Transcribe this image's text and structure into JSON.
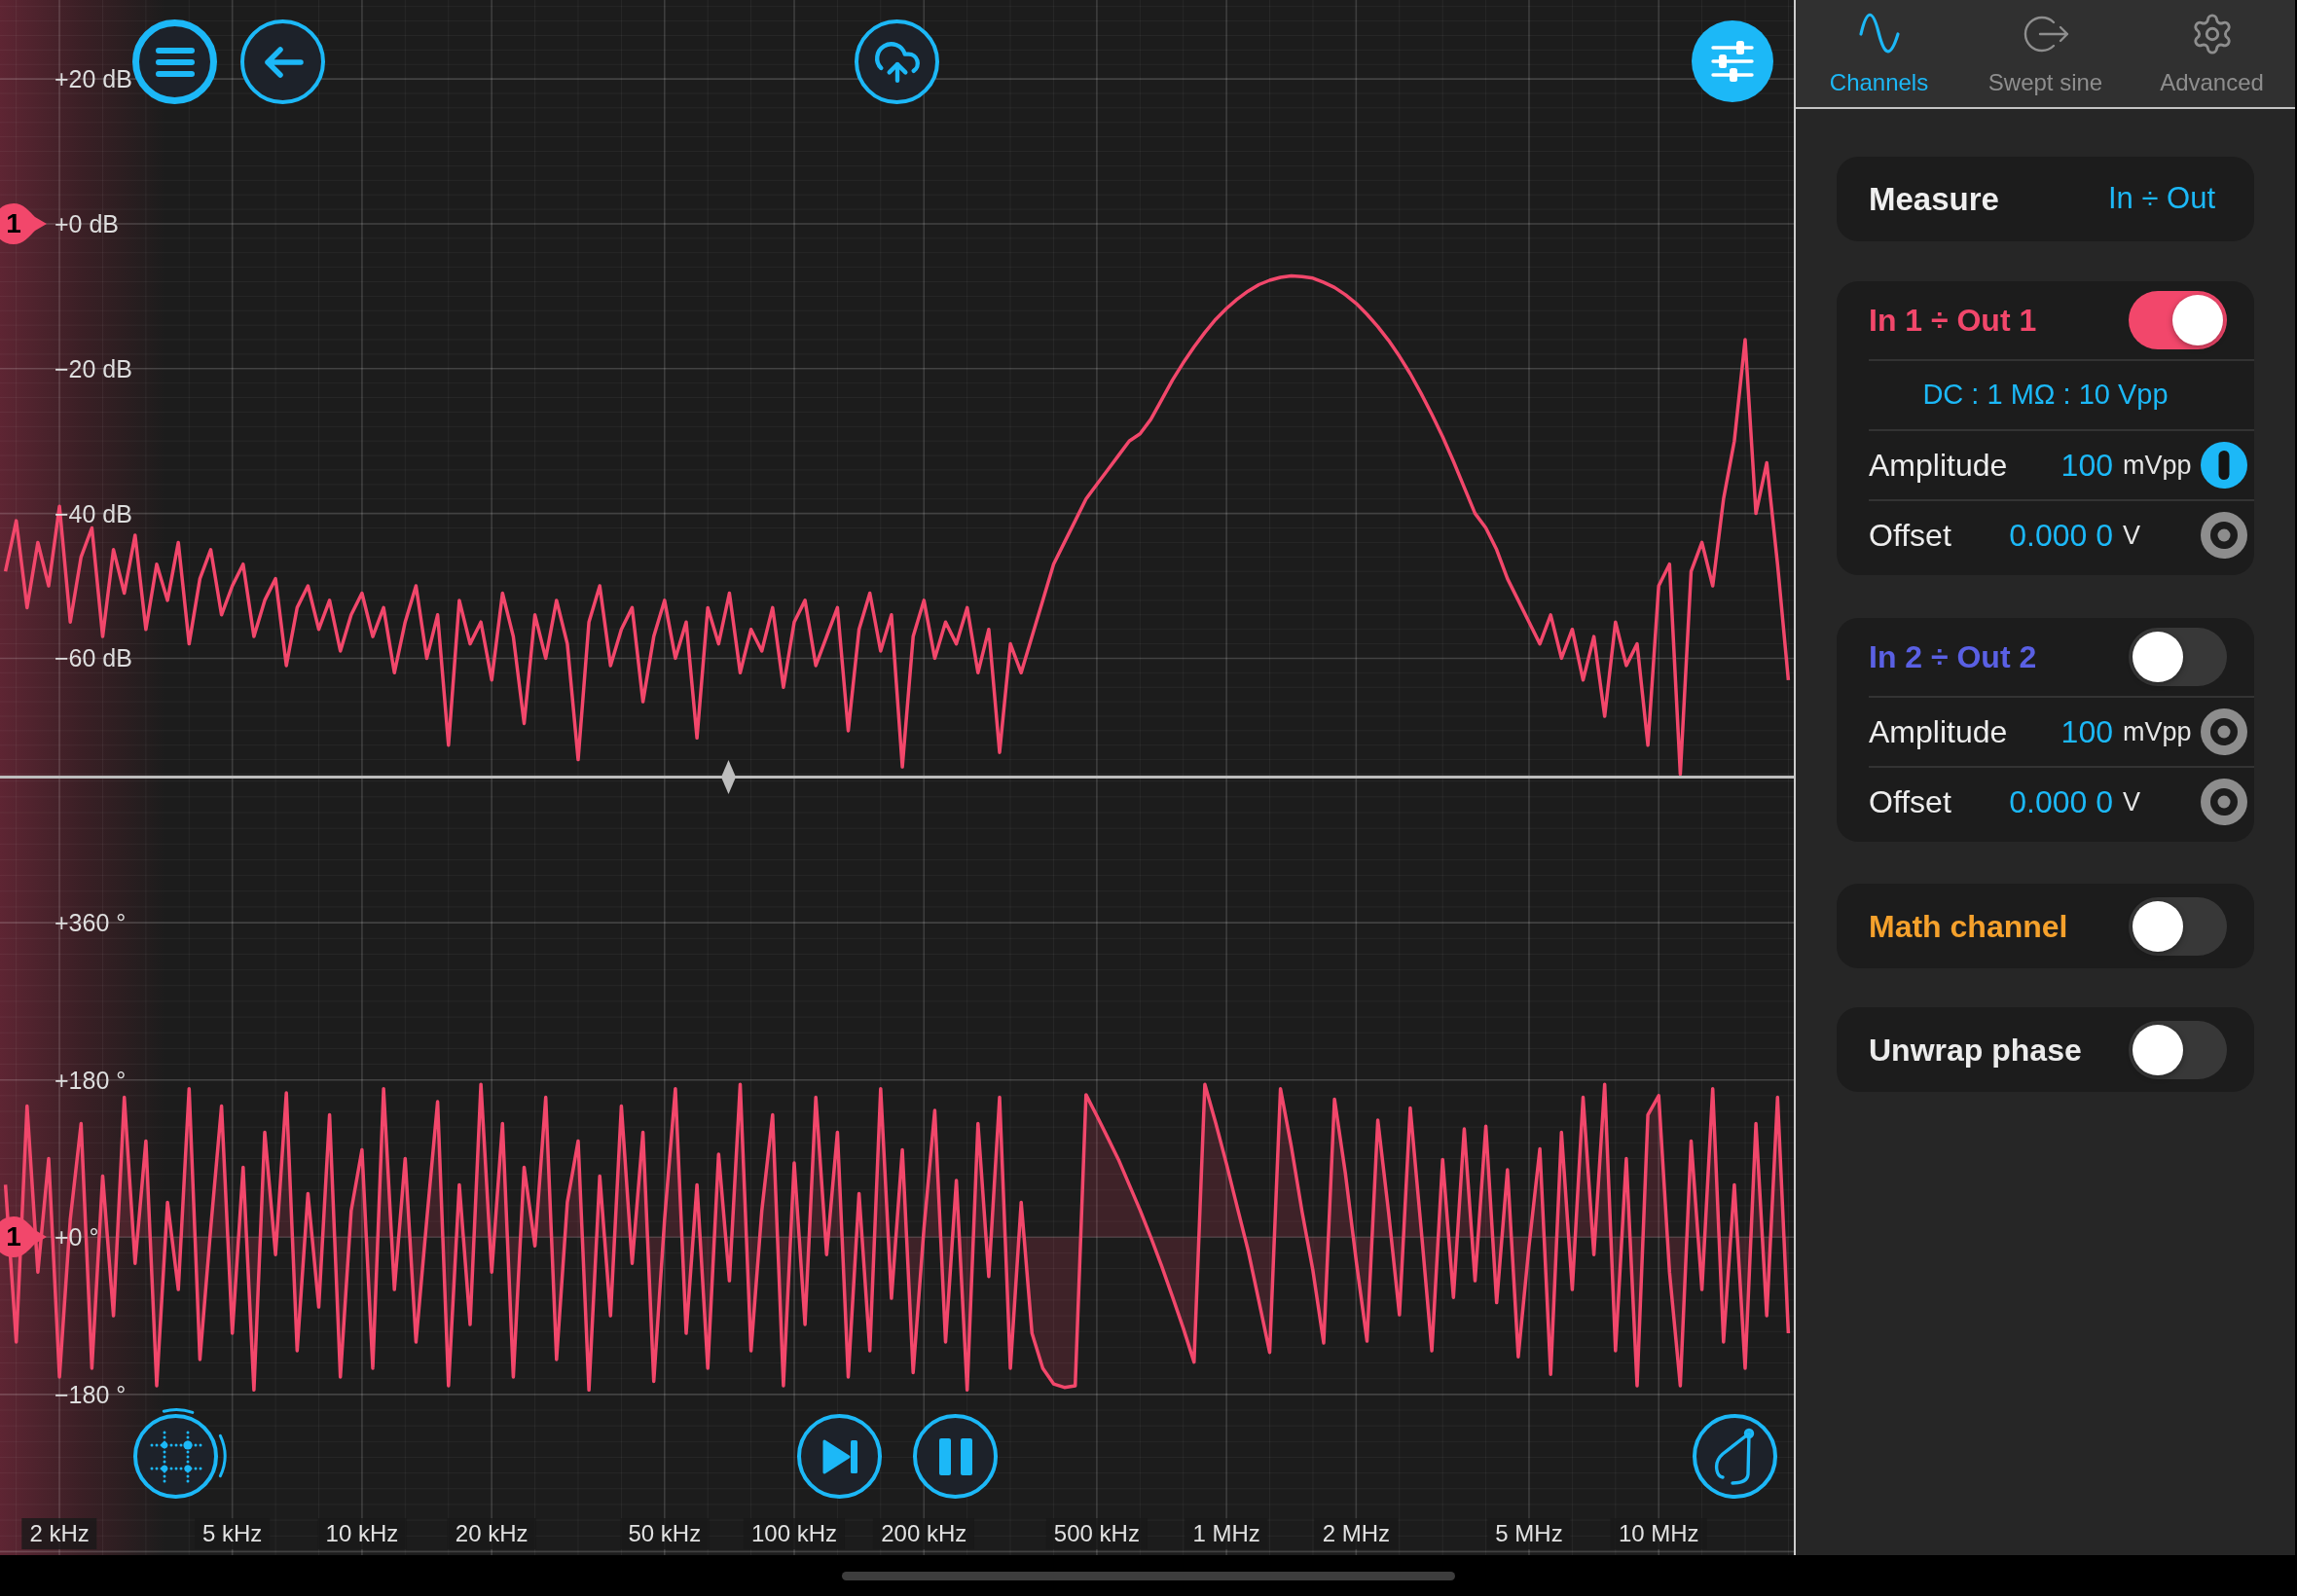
{
  "magnitude_chart": {
    "marker": "1",
    "chart_data": {
      "type": "line",
      "grid": true,
      "ylim": [
        -76.2,
        30.9
      ],
      "yticks": [
        {
          "value": 20,
          "label": "+20 dB"
        },
        {
          "value": 0,
          "label": "+0 dB"
        },
        {
          "value": -20,
          "label": "−20 dB"
        },
        {
          "value": -40,
          "label": "−40 dB"
        },
        {
          "value": -60,
          "label": "−60 dB"
        }
      ],
      "categories": [
        null,
        null,
        null,
        null,
        null,
        null,
        null,
        null,
        null,
        null,
        null,
        null,
        null,
        null,
        null,
        null,
        null,
        null,
        null,
        null,
        null,
        null,
        null,
        null,
        null,
        null,
        null,
        null,
        null,
        null,
        null,
        null,
        null,
        null,
        null,
        null,
        null,
        null,
        null,
        null,
        null,
        null,
        null,
        null,
        null,
        null,
        null,
        null,
        null,
        null,
        null,
        null,
        null,
        null,
        null,
        null,
        null,
        null,
        null,
        null,
        null,
        null,
        null,
        null,
        null,
        null,
        null,
        null,
        null,
        null,
        null,
        null,
        null,
        null,
        null,
        null,
        null,
        null,
        null,
        null,
        null,
        null,
        null,
        null,
        null,
        null,
        null,
        null,
        null,
        null,
        null,
        null,
        null,
        null,
        null,
        null,
        null,
        null,
        null,
        null,
        null,
        null,
        null,
        null,
        null,
        null,
        null,
        null,
        null,
        null,
        null,
        null,
        null,
        null,
        null,
        null,
        null,
        null,
        null,
        null,
        null,
        null,
        null,
        null,
        null,
        null,
        null,
        null,
        null,
        null,
        null,
        null,
        null,
        null,
        null,
        null,
        null,
        null,
        null,
        null,
        null,
        null,
        null,
        null,
        null,
        null,
        null,
        null,
        null,
        null,
        null,
        null,
        null,
        null,
        null,
        null,
        null,
        null,
        null,
        null,
        null,
        null,
        null,
        null,
        null,
        null
      ],
      "series": [
        {
          "color": "#f2476b",
          "values": [
            -48,
            -41,
            -53,
            -44,
            -50,
            -39,
            -55,
            -46,
            -42,
            -57,
            -45,
            -51,
            -43,
            -56,
            -47,
            -52,
            -44,
            -58,
            -49,
            -45,
            -54,
            -50,
            -47,
            -57,
            -52,
            -49,
            -61,
            -53,
            -50,
            -56,
            -52,
            -59,
            -54,
            -51,
            -57,
            -53,
            -62,
            -55,
            -50,
            -60,
            -54,
            -72,
            -52,
            -58,
            -55,
            -63,
            -51,
            -57,
            -69,
            -54,
            -60,
            -52,
            -58,
            -74,
            -55,
            -50,
            -61,
            -56,
            -53,
            -66,
            -57,
            -52,
            -60,
            -55,
            -71,
            -53,
            -58,
            -51,
            -62,
            -56,
            -59,
            -53,
            -64,
            -55,
            -52,
            -61,
            -57,
            -53,
            -70,
            -56,
            -51,
            -59,
            -54,
            -75,
            -57,
            -52,
            -60,
            -55,
            -58,
            -53,
            -62,
            -56,
            -73,
            -58,
            -62,
            -57,
            -52,
            -47,
            -44,
            -41,
            -38,
            -36,
            -34,
            -32,
            -30,
            -29,
            -27,
            -24.3,
            -21.6,
            -19.2,
            -17,
            -15,
            -13.2,
            -11.7,
            -10.4,
            -9.3,
            -8.4,
            -7.8,
            -7.4,
            -7.2,
            -7.3,
            -7.5,
            -8.1,
            -8.8,
            -9.8,
            -11,
            -12.5,
            -14.2,
            -16.1,
            -18.3,
            -20.7,
            -23.4,
            -26.3,
            -29.4,
            -32.8,
            -36.4,
            -40,
            -42,
            -45,
            -49,
            -52,
            -55,
            -58,
            -54,
            -60,
            -56,
            -63,
            -57,
            -68,
            -55,
            -61,
            -58,
            -72,
            -50,
            -47,
            -76,
            -48,
            -44,
            -50,
            -38,
            -30,
            -16,
            -40,
            -33,
            -47,
            -63
          ]
        }
      ]
    }
  },
  "phase_chart": {
    "marker": "1",
    "chart_data": {
      "type": "area",
      "grid": true,
      "ylim": [
        -364,
        525
      ],
      "yticks": [
        {
          "value": 360,
          "label": "+360 °"
        },
        {
          "value": 180,
          "label": "+180 °"
        },
        {
          "value": 0,
          "label": "+0 °"
        },
        {
          "value": -180,
          "label": "−180 °"
        }
      ],
      "categories": [
        null,
        null,
        null,
        null,
        null,
        "2 kHz",
        null,
        null,
        null,
        null,
        null,
        null,
        null,
        null,
        null,
        null,
        null,
        null,
        null,
        null,
        null,
        "5 kHz",
        null,
        null,
        null,
        null,
        null,
        null,
        null,
        null,
        null,
        null,
        null,
        "10 kHz",
        null,
        null,
        null,
        null,
        null,
        null,
        null,
        null,
        null,
        null,
        null,
        "20 kHz",
        null,
        null,
        null,
        null,
        null,
        null,
        null,
        null,
        null,
        null,
        null,
        null,
        null,
        null,
        null,
        "50 kHz",
        null,
        null,
        null,
        null,
        null,
        null,
        null,
        null,
        null,
        null,
        null,
        "100 kHz",
        null,
        null,
        null,
        null,
        null,
        null,
        null,
        null,
        null,
        null,
        null,
        "200 kHz",
        null,
        null,
        null,
        null,
        null,
        null,
        null,
        null,
        null,
        null,
        null,
        null,
        null,
        null,
        null,
        "500 kHz",
        null,
        null,
        null,
        null,
        null,
        null,
        null,
        null,
        null,
        null,
        null,
        "1 MHz",
        null,
        null,
        null,
        null,
        null,
        null,
        null,
        null,
        null,
        null,
        null,
        "2 MHz",
        null,
        null,
        null,
        null,
        null,
        null,
        null,
        null,
        null,
        null,
        null,
        null,
        null,
        null,
        null,
        "5 MHz",
        null,
        null,
        null,
        null,
        null,
        null,
        null,
        null,
        null,
        null,
        null,
        "10 MHz",
        null,
        null,
        null,
        null,
        null,
        null,
        null,
        null,
        null,
        null,
        null,
        null
      ],
      "series": [
        {
          "color": "#f2476b",
          "values": [
            60,
            -120,
            150,
            -40,
            90,
            -160,
            20,
            130,
            -150,
            70,
            -90,
            160,
            -30,
            110,
            -170,
            40,
            -60,
            170,
            -140,
            10,
            150,
            -110,
            80,
            -175,
            120,
            -20,
            165,
            -130,
            50,
            -80,
            140,
            -160,
            30,
            100,
            -150,
            170,
            -60,
            90,
            -120,
            20,
            155,
            -170,
            60,
            -100,
            175,
            -40,
            130,
            -160,
            80,
            -10,
            160,
            -140,
            40,
            110,
            -175,
            70,
            -90,
            150,
            -30,
            120,
            -165,
            20,
            170,
            -110,
            60,
            -150,
            95,
            -50,
            175,
            -130,
            30,
            140,
            -170,
            85,
            -100,
            160,
            -20,
            120,
            -160,
            50,
            -130,
            170,
            -70,
            100,
            -155,
            10,
            145,
            -120,
            65,
            -175,
            130,
            -45,
            160,
            -150,
            40,
            -110,
            -150,
            -168,
            -172,
            -170,
            163,
            139,
            114,
            89,
            60,
            31,
            0,
            -33,
            -68,
            -104,
            -143,
            175,
            131,
            84,
            34,
            -15,
            -73,
            -132,
            170,
            104,
            29,
            -38,
            -121,
            158,
            73,
            -27,
            -119,
            134,
            28,
            -89,
            148,
            11,
            -130,
            89,
            -69,
            124,
            -50,
            127,
            -75,
            77,
            -137,
            -10,
            101,
            -157,
            120,
            -60,
            160,
            -20,
            175,
            -130,
            90,
            -170,
            140,
            162,
            -40,
            -170,
            110,
            -60,
            170,
            -120,
            60,
            -150,
            130,
            -90,
            160,
            -110
          ]
        }
      ]
    }
  },
  "tabs": [
    {
      "label": "Channels",
      "selected": true
    },
    {
      "label": "Swept sine",
      "selected": false
    },
    {
      "label": "Advanced",
      "selected": false
    }
  ],
  "measure": {
    "label": "Measure",
    "value": "In ÷ Out"
  },
  "channels": [
    {
      "title": "In 1 ÷ Out 1",
      "color": "#f2476b",
      "on": true,
      "coupling": "DC : 1 MΩ : 10 Vpp",
      "rows": [
        {
          "label": "Amplitude",
          "value": "100",
          "unit": "mVpp",
          "selected": true
        },
        {
          "label": "Offset",
          "value": "0.000 0",
          "unit": "V",
          "selected": false
        }
      ]
    },
    {
      "title": "In 2 ÷ Out 2",
      "color": "#5a60e4",
      "on": false,
      "rows": [
        {
          "label": "Amplitude",
          "value": "100",
          "unit": "mVpp",
          "selected": false
        },
        {
          "label": "Offset",
          "value": "0.000 0",
          "unit": "V",
          "selected": false
        }
      ]
    }
  ],
  "toggles": [
    {
      "label": "Math channel",
      "color": "#f5a12c",
      "on": false
    },
    {
      "label": "Unwrap phase",
      "color": "#ececec",
      "on": false
    }
  ]
}
